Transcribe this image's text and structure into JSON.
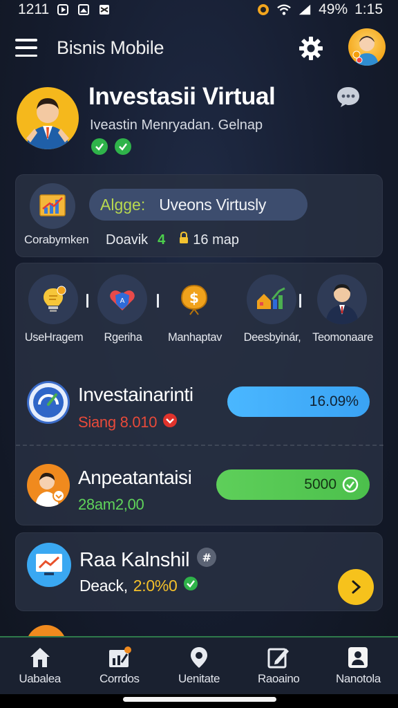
{
  "status_bar": {
    "left_time": "1211",
    "battery": "49%",
    "time": "1:15"
  },
  "app_bar": {
    "title": "Bisnis Mobile"
  },
  "hero": {
    "title": "Investasii Virtual",
    "subtitle": "Iveastin Menryadan. Gelnap"
  },
  "summary_card": {
    "icon_label": "Corabymken",
    "pill_accent": "Algge:",
    "pill_text": "Uveons Virtusly",
    "meta_label": "Doavik",
    "meta_green": "4",
    "meta_value": "16 map"
  },
  "categories": [
    {
      "label": "UseHragem",
      "icon": "lightbulb-icon"
    },
    {
      "label": "Rgeriha",
      "icon": "heart-shield-icon"
    },
    {
      "label": "Manhaptav",
      "icon": "coin-bag-icon"
    },
    {
      "label": "Deesbyinár,",
      "icon": "house-chart-icon"
    },
    {
      "label": "Teomonaare",
      "icon": "businessman-icon"
    }
  ],
  "rows": [
    {
      "title": "Investainarinti",
      "sub": "Siang 8.010",
      "progress": "16.09%",
      "status": "down"
    },
    {
      "title": "Anpeatantaisi",
      "sub": "28am2,00",
      "progress": "5000",
      "status": "check"
    }
  ],
  "feature_card": {
    "title": "Raa Kalnshil",
    "sub_label": "Deack,",
    "sub_value": "2:0%0"
  },
  "bottom_nav": [
    {
      "label": "Uabalea",
      "icon": "home-icon"
    },
    {
      "label": "Corrdos",
      "icon": "chart-card-icon"
    },
    {
      "label": "Uenitate",
      "icon": "location-icon"
    },
    {
      "label": "Raoaino",
      "icon": "edit-doc-icon"
    },
    {
      "label": "Nanotola",
      "icon": "profile-icon"
    }
  ],
  "colors": {
    "background": "#151c2e",
    "card": "#283042",
    "accent_blue": "#4ab7ff",
    "accent_green": "#4cc04c",
    "accent_yellow": "#f6c21c",
    "danger": "#e0332c"
  }
}
